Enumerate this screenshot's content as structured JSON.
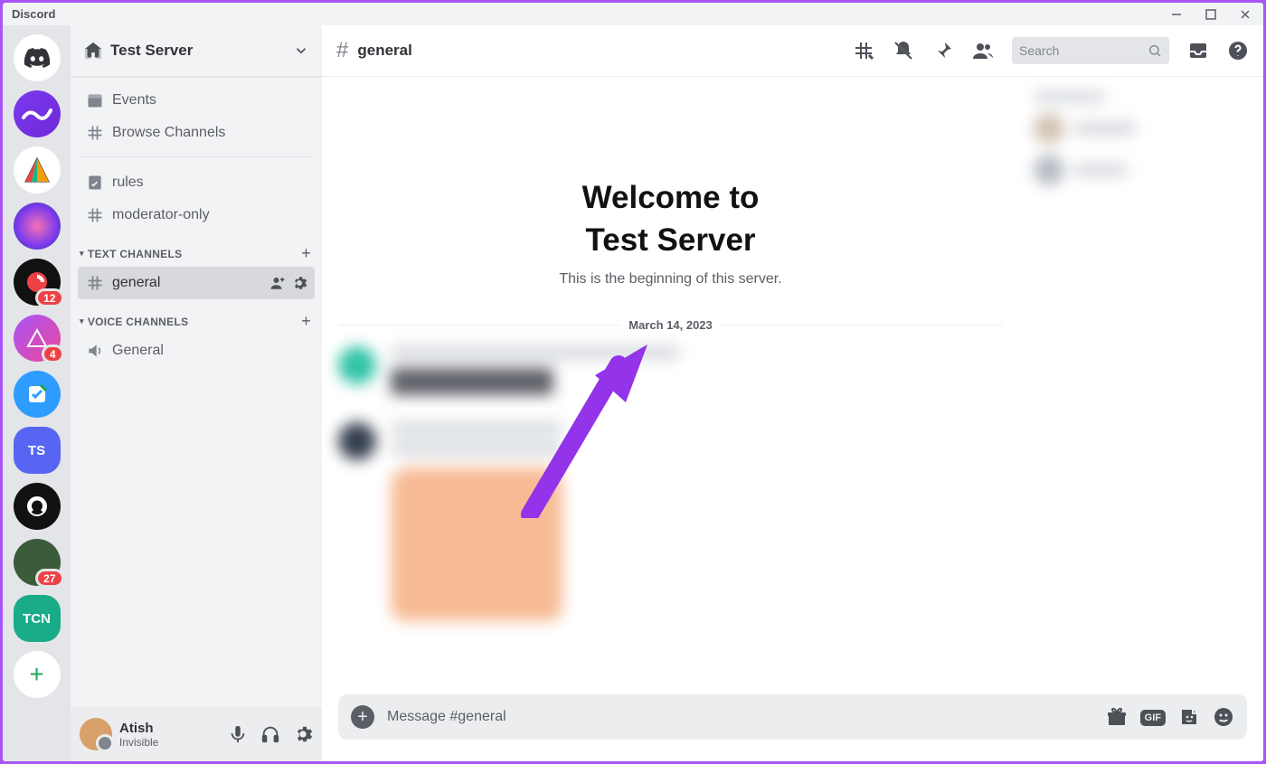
{
  "app": {
    "name": "Discord"
  },
  "server_badges": [
    "12",
    "4",
    "27"
  ],
  "server_avatar_labels": {
    "ts": "TS",
    "tcn": "TCN"
  },
  "sidebar": {
    "server_name": "Test Server",
    "events": "Events",
    "browse": "Browse Channels",
    "top_channels": [
      "rules",
      "moderator-only"
    ],
    "text_category": "TEXT CHANNELS",
    "text_channels": [
      "general"
    ],
    "voice_category": "VOICE CHANNELS",
    "voice_channels": [
      "General"
    ]
  },
  "user": {
    "name": "Atish",
    "status": "Invisible"
  },
  "header": {
    "channel": "general",
    "search_placeholder": "Search"
  },
  "welcome": {
    "line1": "Welcome to",
    "line2": "Test Server",
    "subtitle": "This is the beginning of this server."
  },
  "date_separator": "March 14, 2023",
  "composer": {
    "placeholder": "Message #general",
    "gif": "GIF"
  }
}
